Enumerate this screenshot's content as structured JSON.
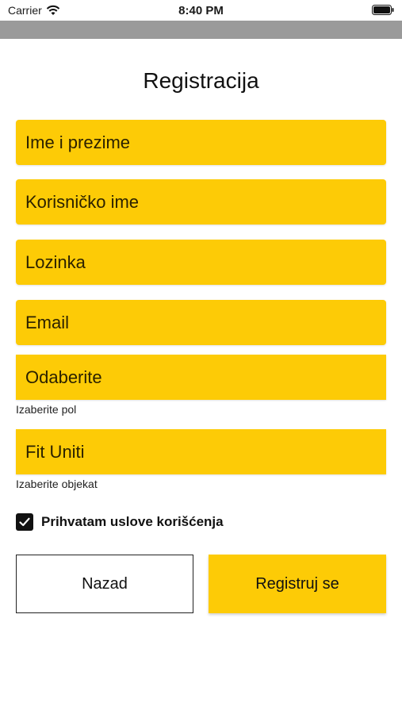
{
  "status_bar": {
    "carrier": "Carrier",
    "time": "8:40 PM",
    "wifi_icon": "wifi-icon",
    "battery_icon": "battery-icon"
  },
  "form": {
    "title": "Registracija",
    "full_name_placeholder": "Ime i prezime",
    "username_placeholder": "Korisničko ime",
    "password_placeholder": "Lozinka",
    "email_placeholder": "Email",
    "gender_value": "Odaberite",
    "gender_helper": "Izaberite pol",
    "facility_value": "Fit Uniti",
    "facility_helper": "Izaberite objekat",
    "terms_label": "Prihvatam uslove korišćenja",
    "terms_checked": true
  },
  "buttons": {
    "back_label": "Nazad",
    "register_label": "Registruj se"
  },
  "colors": {
    "accent": "#fdcb06",
    "nav_strip": "#9a9a9a",
    "text": "#1a1a1a"
  }
}
